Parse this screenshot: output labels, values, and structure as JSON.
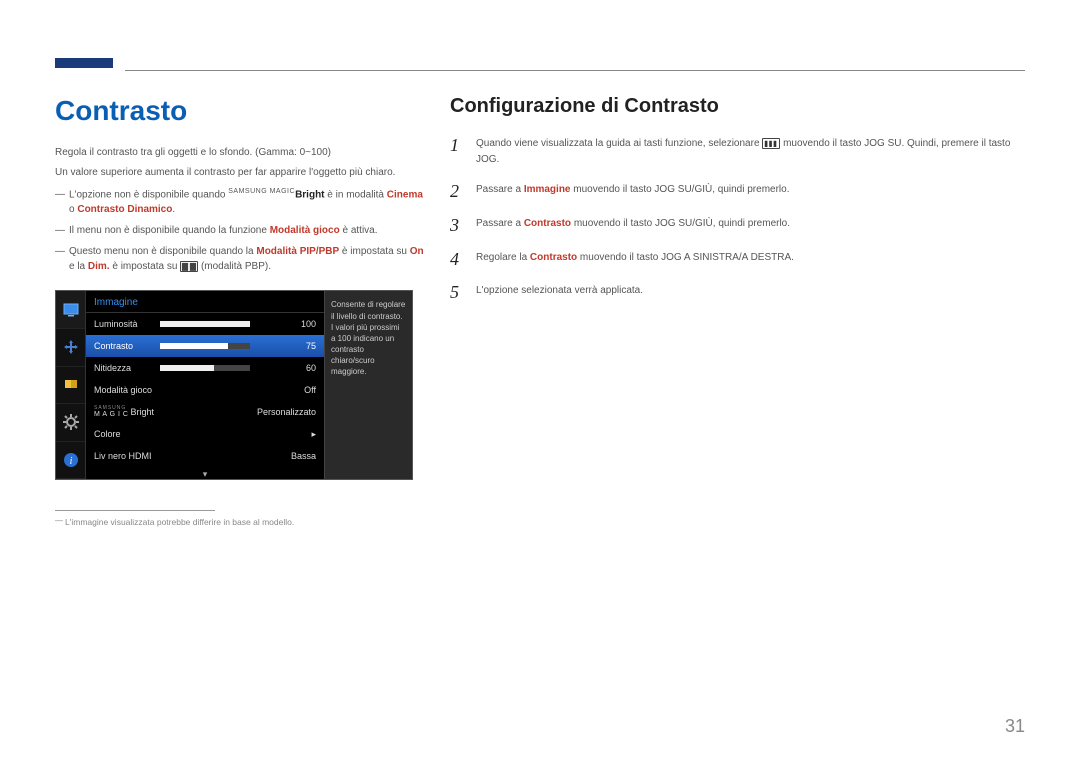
{
  "page_number": "31",
  "left": {
    "title": "Contrasto",
    "intro1": "Regola il contrasto tra gli oggetti e lo sfondo. (Gamma: 0~100)",
    "intro2": "Un valore superiore aumenta il contrasto per far apparire l'oggetto più chiaro.",
    "note1_pre": "L'opzione non è disponibile quando ",
    "note1_magic": "SAMSUNG MAGIC",
    "note1_bright": "Bright",
    "note1_mid": " è in modalità ",
    "note1_cinema": "Cinema",
    "note1_or": " o ",
    "note1_dinamico": "Contrasto Dinamico",
    "note1_end": ".",
    "note2_pre": "Il menu non è disponibile quando la funzione ",
    "note2_hl": "Modalità gioco",
    "note2_post": " è attiva.",
    "note3_pre": "Questo menu non è disponibile quando la ",
    "note3_hl1": "Modalità PIP/PBP",
    "note3_mid": " è impostata su ",
    "note3_on": "On",
    "note3_and": " e la ",
    "note3_dim": "Dim.",
    "note3_post": " è impostata su ",
    "note3_end": " (modalità PBP).",
    "footnote": "L'immagine visualizzata potrebbe differire in base al modello."
  },
  "osd": {
    "header": "Immagine",
    "rows": {
      "luminosita": {
        "label": "Luminosità",
        "value": "100",
        "fill": 100
      },
      "contrasto": {
        "label": "Contrasto",
        "value": "75",
        "fill": 75
      },
      "nitidezza": {
        "label": "Nitidezza",
        "value": "60",
        "fill": 60
      },
      "gioco": {
        "label": "Modalità gioco",
        "value": "Off"
      },
      "magicbright_pre": "SAMSUNG",
      "magicbright_main": "M A G I C",
      "magicbright_post": "Bright",
      "magicbright_value": "Personalizzato",
      "colore": {
        "label": "Colore",
        "value": "▸"
      },
      "hdmi": {
        "label": "Liv nero HDMI",
        "value": "Bassa"
      }
    },
    "arrow": "▾",
    "help": "Consente di regolare il livello di contrasto. I valori più prossimi a 100 indicano un contrasto chiaro/scuro maggiore."
  },
  "right": {
    "title": "Configurazione di Contrasto",
    "steps": [
      {
        "n": "1",
        "pre": "Quando viene visualizzata la guida ai tasti funzione, selezionare ",
        "post": " muovendo il tasto JOG SU. Quindi, premere il tasto JOG."
      },
      {
        "n": "2",
        "pre": "Passare a ",
        "hl": "Immagine",
        "post": " muovendo il tasto JOG SU/GIÙ, quindi premerlo."
      },
      {
        "n": "3",
        "pre": "Passare a ",
        "hl": "Contrasto",
        "post": " muovendo il tasto JOG SU/GIÙ, quindi premerlo."
      },
      {
        "n": "4",
        "pre": "Regolare la ",
        "hl": "Contrasto",
        "post": " muovendo il tasto JOG A SINISTRA/A DESTRA."
      },
      {
        "n": "5",
        "pre": "L'opzione selezionata verrà applicata.",
        "hl": "",
        "post": ""
      }
    ]
  }
}
